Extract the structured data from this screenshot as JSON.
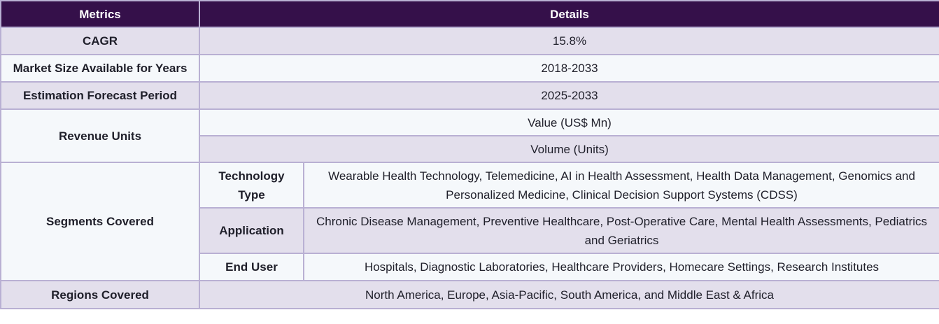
{
  "header": {
    "metrics": "Metrics",
    "details": "Details"
  },
  "rows": {
    "cagr": {
      "label": "CAGR",
      "value": "15.8%"
    },
    "market_size": {
      "label": "Market Size Available for Years",
      "value": "2018-2033"
    },
    "forecast": {
      "label": "Estimation Forecast Period",
      "value": "2025-2033"
    },
    "revenue": {
      "label": "Revenue Units",
      "value1": "Value (US$ Mn)",
      "value2": "Volume (Units)"
    },
    "segments": {
      "label": "Segments Covered",
      "technology": {
        "label": "Technology Type",
        "value": "Wearable Health Technology, Telemedicine, AI in Health Assessment, Health Data Management, Genomics and Personalized Medicine, Clinical Decision Support Systems (CDSS)"
      },
      "application": {
        "label": "Application",
        "value": "Chronic Disease Management, Preventive Healthcare, Post-Operative Care, Mental Health Assessments, Pediatrics and Geriatrics"
      },
      "end_user": {
        "label": "End User",
        "value": "Hospitals, Diagnostic Laboratories, Healthcare Providers, Homecare Settings, Research Institutes"
      }
    },
    "regions": {
      "label": "Regions Covered",
      "value": "North America, Europe, Asia-Pacific, South America, and Middle East & Africa"
    }
  },
  "colors": {
    "header_bg": "#35104a",
    "row_shade": "#e3dfec",
    "row_light": "#f5f8fb",
    "border": "#b9b0d3"
  }
}
